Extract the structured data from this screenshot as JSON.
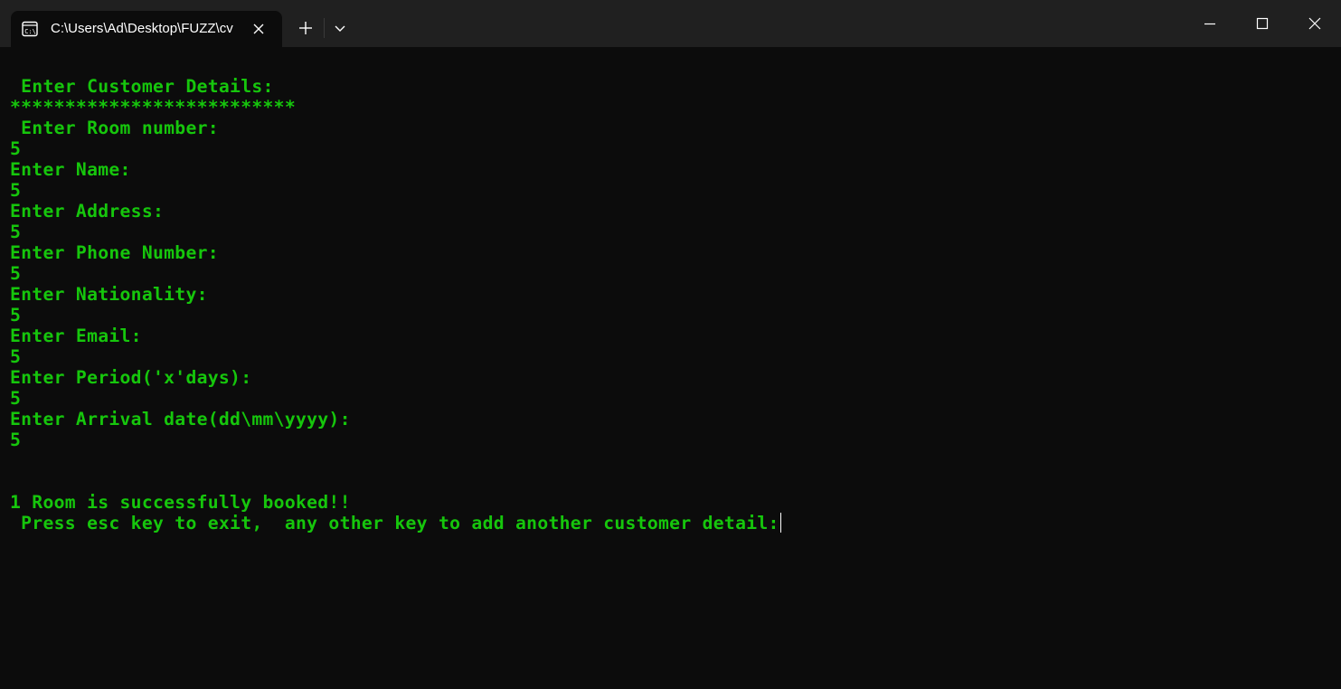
{
  "window": {
    "tab_title": "C:\\Users\\Ad\\Desktop\\FUZZ\\cv",
    "tab_icon": "terminal-icon"
  },
  "console": {
    "text_color": "#16c60c",
    "background": "#0c0c0c",
    "lines": [
      " Enter Customer Details:",
      "**************************",
      " Enter Room number:",
      "5",
      "Enter Name:",
      "5",
      "Enter Address:",
      "5",
      "Enter Phone Number:",
      "5",
      "Enter Nationality:",
      "5",
      "Enter Email:",
      "5",
      "Enter Period('x'days):",
      "5",
      "Enter Arrival date(dd\\mm\\yyyy):",
      "5",
      "",
      "",
      "1 Room is successfully booked!!",
      " Press esc key to exit,  any other key to add another customer detail:"
    ]
  }
}
